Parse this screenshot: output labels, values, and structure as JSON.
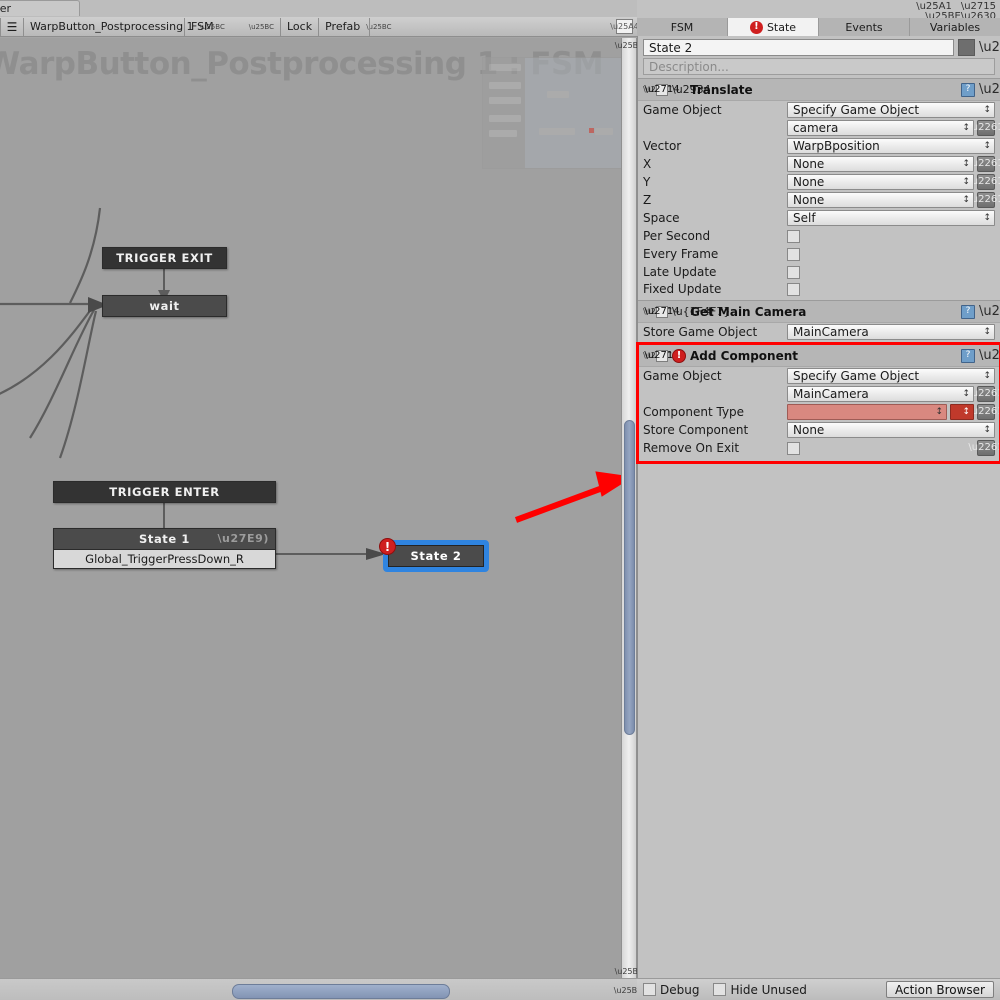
{
  "window": {
    "tab_label": "aker",
    "controls": {
      "maximize": "maximize-icon",
      "close": "close-icon",
      "menu": "panel-menu-icon"
    }
  },
  "toolbar": {
    "hamburger": "☰",
    "fsm_component": "WarpButton_Postprocessing 1",
    "fsm_select": "FSM",
    "lock": "Lock",
    "prefab": "Prefab",
    "layout_icon": "layout-icon"
  },
  "graph": {
    "title": "WarpButton_Postprocessing 1 : FSM",
    "nodes": {
      "trigger_exit": "TRIGGER EXIT",
      "wait": "wait",
      "trigger_enter": "TRIGGER ENTER",
      "state1_title": "State 1",
      "state1_event": "Global_TriggerPressDown_R",
      "state2_title": "State 2",
      "error_mark": "!"
    },
    "annotation_color": "#ff0000"
  },
  "inspector": {
    "tabs": [
      {
        "label": "FSM",
        "active": false,
        "error": false
      },
      {
        "label": "State",
        "active": true,
        "error": true
      },
      {
        "label": "Events",
        "active": false,
        "error": false
      },
      {
        "label": "Variables",
        "active": false,
        "error": false
      }
    ],
    "state_name": "State 2",
    "description_placeholder": "Description...",
    "color_swatch": "#6e6e6e",
    "actions": [
      {
        "name": "Translate",
        "enabled": true,
        "icon": "translate-axis-icon",
        "error": false,
        "highlight": false,
        "fields": [
          {
            "label": "Game Object",
            "type": "popup",
            "value": "Specify Game Object",
            "eq": false
          },
          {
            "label": "",
            "type": "popup",
            "value": "camera",
            "eq": true
          },
          {
            "label": "Vector",
            "type": "popup",
            "value": "WarpBposition",
            "eq": false
          },
          {
            "label": "X",
            "type": "popup",
            "value": "None",
            "eq": true
          },
          {
            "label": "Y",
            "type": "popup",
            "value": "None",
            "eq": true
          },
          {
            "label": "Z",
            "type": "popup",
            "value": "None",
            "eq": true
          },
          {
            "label": "Space",
            "type": "popup",
            "value": "Self",
            "eq": false
          },
          {
            "label": "Per Second",
            "type": "checkbox",
            "value": "",
            "eq": false
          },
          {
            "label": "Every Frame",
            "type": "checkbox",
            "value": "",
            "eq": false
          },
          {
            "label": "Late Update",
            "type": "checkbox",
            "value": "",
            "eq": false
          },
          {
            "label": "Fixed Update",
            "type": "checkbox",
            "value": "",
            "eq": false
          }
        ]
      },
      {
        "name": "Get Main Camera",
        "enabled": true,
        "icon": "camera-icon",
        "error": false,
        "highlight": false,
        "fields": [
          {
            "label": "Store Game Object",
            "type": "popup",
            "value": "MainCamera",
            "eq": false
          }
        ]
      },
      {
        "name": "Add Component",
        "enabled": true,
        "icon": "",
        "error": true,
        "highlight": true,
        "fields": [
          {
            "label": "Game Object",
            "type": "popup",
            "value": "Specify Game Object",
            "eq": false
          },
          {
            "label": "",
            "type": "popup",
            "value": "MainCamera",
            "eq": true
          },
          {
            "label": "Component Type",
            "type": "popup-error",
            "value": "",
            "eq": true
          },
          {
            "label": "Store Component",
            "type": "popup",
            "value": "None",
            "eq": false
          },
          {
            "label": "Remove On Exit",
            "type": "checkbox",
            "value": "",
            "eq": true
          }
        ]
      }
    ],
    "footer": {
      "debug": "Debug",
      "hide_unused": "Hide Unused",
      "action_browser": "Action Browser"
    }
  }
}
